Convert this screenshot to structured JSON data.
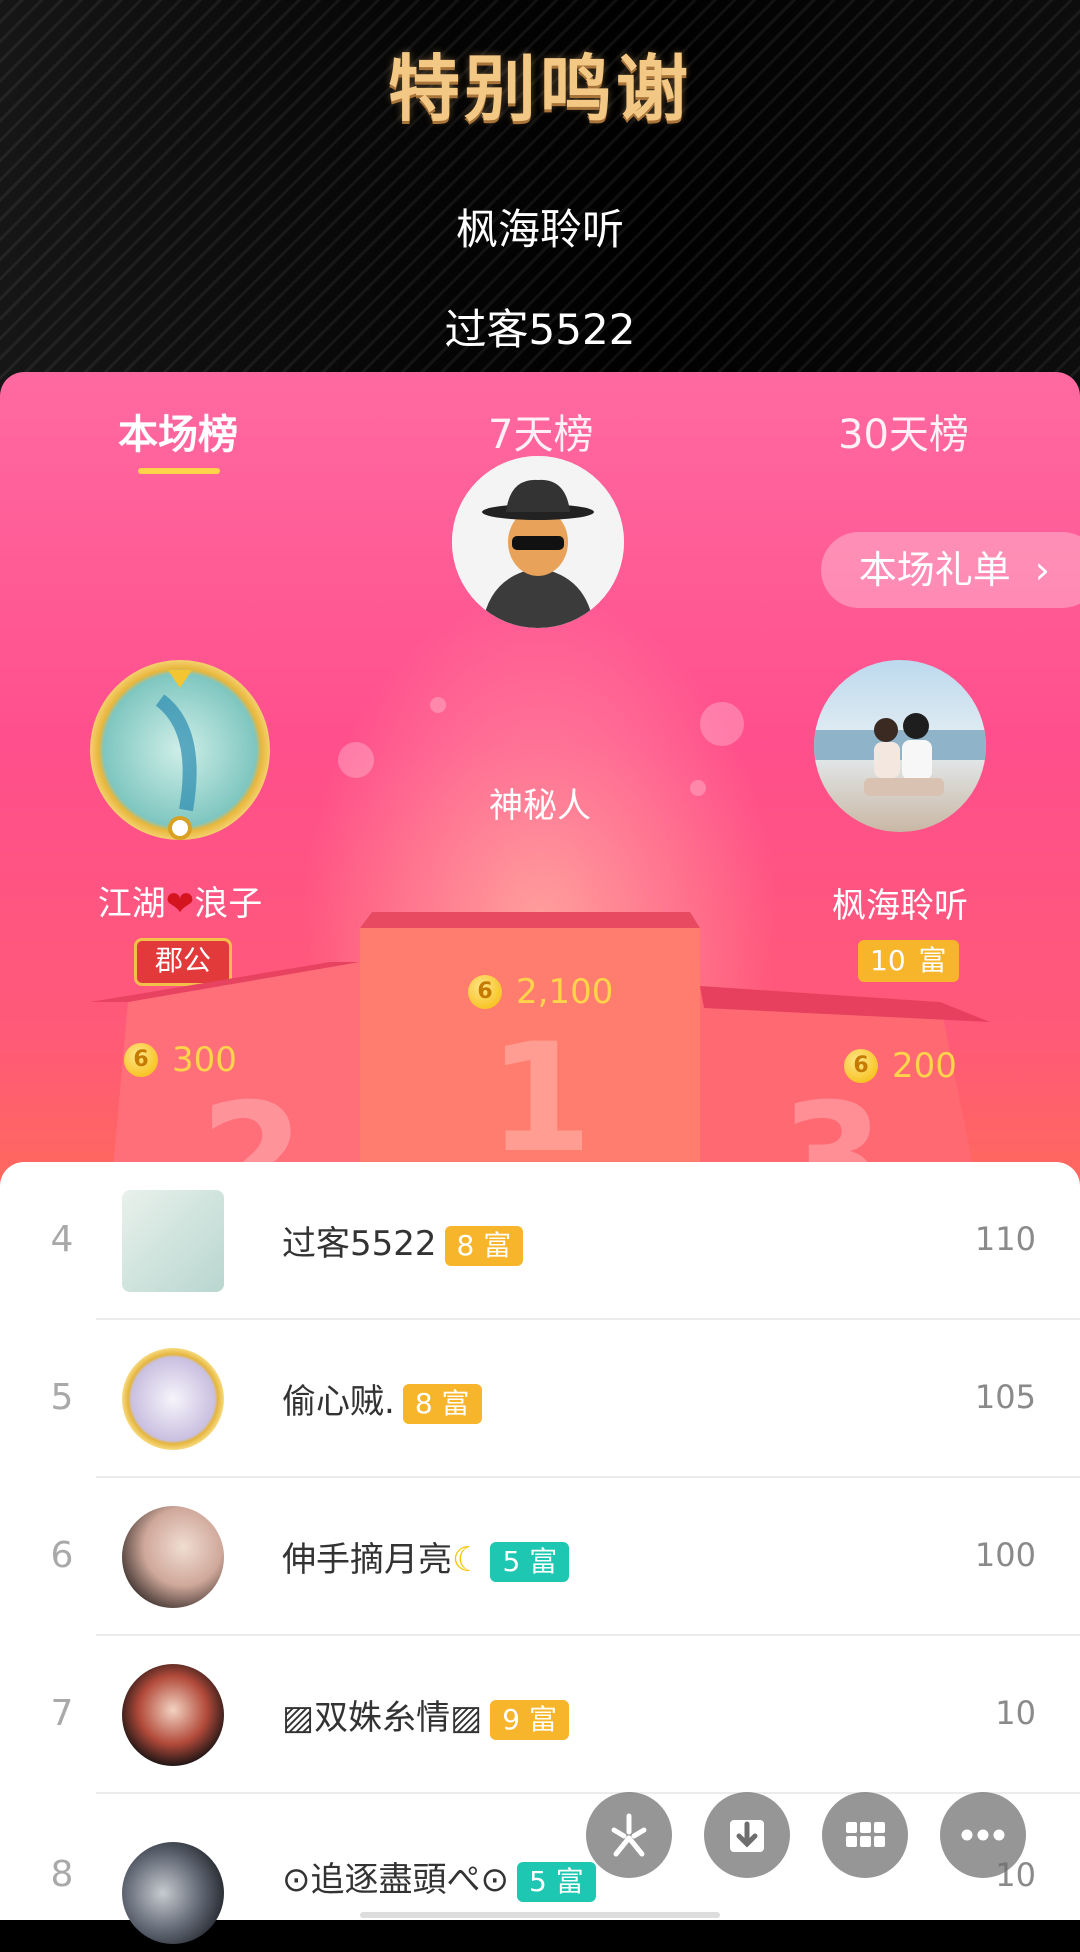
{
  "header": {
    "title": "特别鸣谢",
    "thanks": [
      "枫海聆听",
      "过客5522"
    ]
  },
  "tabs": [
    {
      "label": "本场榜",
      "active": true
    },
    {
      "label": "7天榜",
      "active": false
    },
    {
      "label": "30天榜",
      "active": false
    }
  ],
  "gift_list_button": "本场礼单",
  "podium": {
    "first": {
      "name": "神秘人",
      "coins": "2,100"
    },
    "second": {
      "name_left": "江湖",
      "name_right": "浪子",
      "badge": "郡公",
      "coins": "300"
    },
    "third": {
      "name": "枫海聆听",
      "badge_level": "10",
      "badge_type": "富",
      "coins": "200"
    },
    "block_numbers": [
      "2",
      "1",
      "3"
    ]
  },
  "rows": [
    {
      "rank": "4",
      "name": "过客5522",
      "level": "8",
      "type": "富",
      "score": "110",
      "badge_color": "gold"
    },
    {
      "rank": "5",
      "name": "偷心贼.",
      "level": "8",
      "type": "富",
      "score": "105",
      "badge_color": "gold"
    },
    {
      "rank": "6",
      "name": "伸手摘月亮",
      "level": "5",
      "type": "富",
      "score": "100",
      "badge_color": "teal"
    },
    {
      "rank": "7",
      "name": "▨双姝糸情▨",
      "level": "9",
      "type": "富",
      "score": "10",
      "badge_color": "gold"
    },
    {
      "rank": "8",
      "name": "⊙追逐盡頭ぺ⊙",
      "level": "5",
      "type": "富",
      "score": "10",
      "badge_color": "teal"
    }
  ],
  "coin_glyph": "6",
  "colors": {
    "accent_pink": "#ff4f8c",
    "gold": "#f7b52b",
    "teal": "#1dc7b2",
    "coin": "#ffd34a"
  },
  "icons": [
    "chevron-right-icon",
    "heart-icon",
    "moon-emoji",
    "refresh-icon",
    "download-icon",
    "grid-icon",
    "more-icon"
  ]
}
